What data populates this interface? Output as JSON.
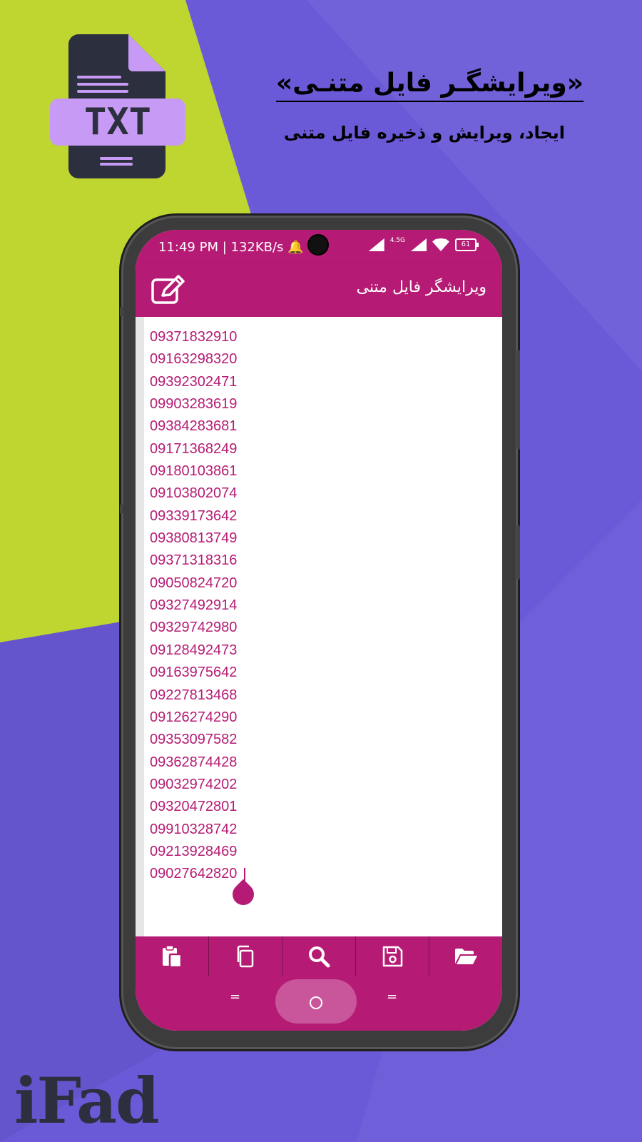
{
  "banner": {
    "title": "«ویرایشگـر فایل متنـی»",
    "subtitle": "ایجاد، ویرایش و ذخیره فایل متنی",
    "icon_text": "TXT",
    "brand": "iFad"
  },
  "status_bar": {
    "time_speed": "11:49 PM | 132KB/s",
    "network": "4.5G",
    "battery": "61"
  },
  "app_bar": {
    "title": "ویرایشگر فایل متنی",
    "edit_icon": "edit-icon"
  },
  "editor": {
    "lines": [
      "09371832910",
      "09163298320",
      "09392302471",
      "09903283619",
      "09384283681",
      "09171368249",
      "09180103861",
      "09103802074",
      "09339173642",
      "09380813749",
      "09371318316",
      "09050824720",
      "09327492914",
      "09329742980",
      "09128492473",
      "09163975642",
      "09227813468",
      "09126274290",
      "09353097582",
      "09362874428",
      "09032974202",
      "09320472801",
      "09910328742",
      "09213928469",
      "09027642820"
    ]
  },
  "toolbar": {
    "tools": [
      "paste-icon",
      "copy-icon",
      "search-icon",
      "save-icon",
      "open-folder-icon"
    ]
  },
  "colors": {
    "accent": "#b51b74",
    "background": "#6a5ad8",
    "green": "#bfd630",
    "icon_lilac": "#c79af5",
    "dark": "#2c2f3e"
  }
}
